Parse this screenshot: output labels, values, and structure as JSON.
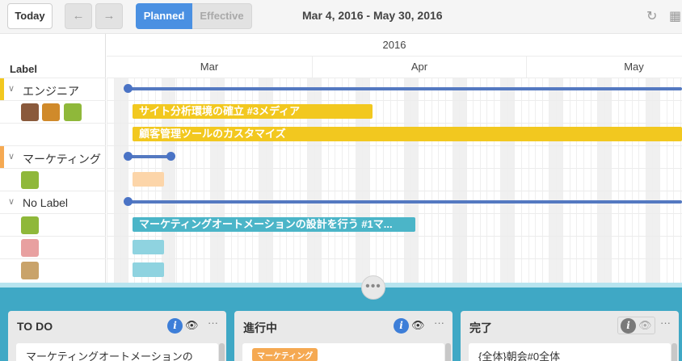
{
  "toolbar": {
    "today_label": "Today",
    "prev_label": "←",
    "next_label": "→",
    "planned_label": "Planned",
    "effective_label": "Effective",
    "date_range": "Mar 4, 2016 - May 30, 2016",
    "refresh_icon": "↻",
    "calendar_icon": "▦"
  },
  "gantt": {
    "label_header": "Label",
    "year": "2016",
    "months": [
      "Mar",
      "Apr",
      "May"
    ],
    "groups": [
      {
        "label": "エンジニア",
        "color": "#f2c81f"
      },
      {
        "label": "マーケティング",
        "color": "#f5a952"
      },
      {
        "label": "No Label",
        "color": ""
      }
    ],
    "tasks": [
      {
        "title": "サイト分析環境の確立 #3メディア",
        "color": "#f2c81f"
      },
      {
        "title": "顧客管理ツールのカスタマイズ",
        "color": "#f2c81f"
      },
      {
        "title": "",
        "color": "#fcd5a9"
      },
      {
        "title": "マーケティングオートメーションの設計を行う #1マ...",
        "color": "#4bb5c8"
      },
      {
        "title": "",
        "color": "#8fd3e0"
      },
      {
        "title": "",
        "color": "#8fd3e0"
      }
    ],
    "line_color": "#5479c1"
  },
  "kanban": {
    "handle_label": "•••",
    "lists": [
      {
        "title": "TO DO",
        "card": "マーケティングオートメーションの",
        "more": "···"
      },
      {
        "title": "進行中",
        "card_tag": "マーケティング",
        "more": "···"
      },
      {
        "title": "完了",
        "card": "{全体}朝会#0全体",
        "more": "···"
      }
    ],
    "info_icon": "i",
    "eye_icon": "👁"
  }
}
